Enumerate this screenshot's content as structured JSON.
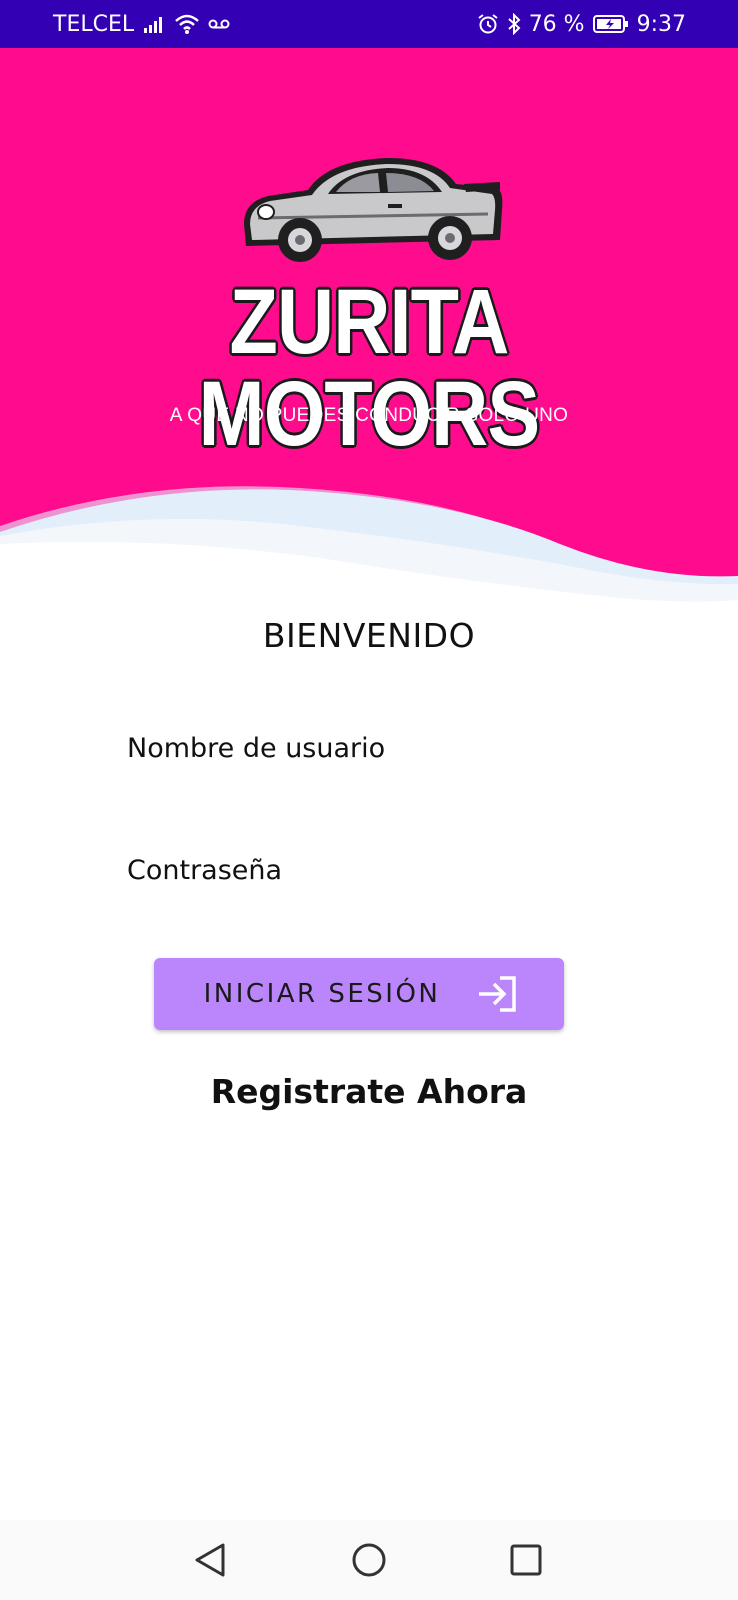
{
  "status_bar": {
    "carrier": "TELCEL",
    "battery": "76 %",
    "time": "9:37",
    "icons": [
      "signal-icon",
      "wifi-icon",
      "voicemail-icon",
      "alarm-icon",
      "bluetooth-icon",
      "battery-charging-icon"
    ]
  },
  "header": {
    "logo_title": "ZURITA MOTORS",
    "logo_slogan": "A QUE NO PUEDES CONDUCIR SOLO UNO",
    "background_color": "#fe0b8e"
  },
  "form": {
    "welcome": "BIENVENIDO",
    "username_placeholder": "Nombre de usuario",
    "password_placeholder": "Contraseña",
    "login_label": "INICIAR SESIÓN",
    "login_icon": "login-icon",
    "register_label": "Registrate Ahora",
    "button_color": "#bb86fc"
  },
  "nav_bar": {
    "icons": [
      "back-icon",
      "home-icon",
      "recents-icon"
    ]
  }
}
